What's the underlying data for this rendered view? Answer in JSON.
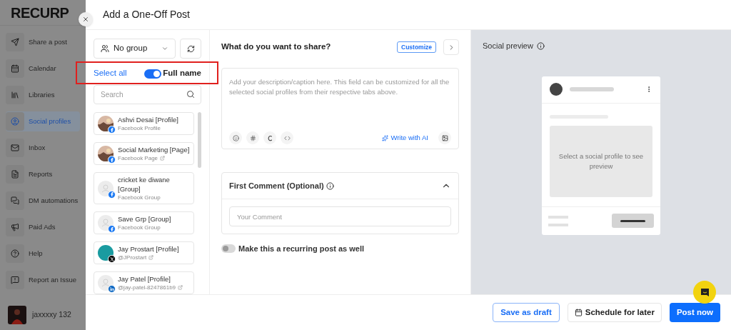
{
  "sidebar": {
    "logo": "RECURP",
    "items": [
      {
        "label": "Share a post",
        "selected": false
      },
      {
        "label": "Calendar",
        "selected": false
      },
      {
        "label": "Libraries",
        "selected": false
      },
      {
        "label": "Social profiles",
        "selected": true
      },
      {
        "label": "Inbox",
        "selected": false
      },
      {
        "label": "Reports",
        "selected": false
      },
      {
        "label": "DM automations",
        "selected": false
      },
      {
        "label": "Paid Ads",
        "selected": false
      },
      {
        "label": "Help",
        "selected": false
      },
      {
        "label": "Report an Issue",
        "selected": false
      }
    ],
    "user": {
      "name": "jaxxxxy 132"
    }
  },
  "dialog": {
    "title": "Add a One-Off Post",
    "profiles_panel": {
      "group": "No group",
      "select_all": "Select all",
      "full_name_toggle": {
        "label": "Full name",
        "on": true
      },
      "search": {
        "placeholder": "Search"
      },
      "profiles": [
        {
          "name": "Ashvi Desai [Profile]",
          "subtitle": "Facebook Profile",
          "network": {
            "kind": "facebook"
          },
          "external_link": false
        },
        {
          "name": "Social Marketing [Page]",
          "subtitle": "Facebook Page",
          "network": {
            "kind": "facebook"
          },
          "external_link": true
        },
        {
          "name": "cricket ke diwane [Group]",
          "subtitle": "Facebook Group",
          "network": {
            "kind": "facebook"
          },
          "avatar": {
            "kind": "placeholder"
          },
          "external_link": false
        },
        {
          "name": "Save Grp [Group]",
          "subtitle": "Facebook Group",
          "network": {
            "kind": "facebook"
          },
          "avatar": {
            "kind": "placeholder"
          },
          "external_link": false
        },
        {
          "name": "Jay Prostart [Profile]",
          "subtitle": "@JProstart",
          "network": {
            "kind": "x"
          },
          "avatar": {
            "kind": "teal"
          },
          "external_link": true
        },
        {
          "name": "Jay Patel [Profile]",
          "subtitle": "@jay-patel-8247861b9",
          "network": {
            "kind": "linkedin"
          },
          "avatar": {
            "kind": "placeholder"
          },
          "external_link": true
        }
      ]
    },
    "compose": {
      "heading": "What do you want to share?",
      "customize": "Customize",
      "caption": {
        "placeholder": "Add your description/caption here. This field can be customized for all the selected social profiles from their respective tabs above."
      },
      "write_with_ai": "Write with AI",
      "first_comment": {
        "title": "First Comment (Optional)",
        "expanded": true,
        "input": {
          "placeholder": "Your Comment"
        }
      },
      "recurring_toggle": {
        "label": "Make this a recurring post as well",
        "on": false
      }
    },
    "preview": {
      "title": "Social preview",
      "message": "Select a social profile to see preview"
    },
    "footer": {
      "buttons": [
        {
          "label": "Save as draft",
          "kind": "outline"
        },
        {
          "label": "Schedule for later",
          "kind": "calendar"
        },
        {
          "label": "Post now",
          "kind": "primary"
        }
      ]
    }
  }
}
